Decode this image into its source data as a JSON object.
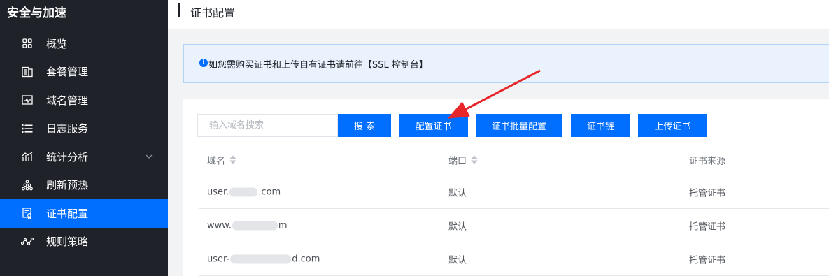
{
  "sidebar": {
    "title": "安全与加速",
    "items": [
      {
        "label": "概览",
        "icon": "grid-icon"
      },
      {
        "label": "套餐管理",
        "icon": "package-icon"
      },
      {
        "label": "域名管理",
        "icon": "domain-icon"
      },
      {
        "label": "日志服务",
        "icon": "list-icon"
      },
      {
        "label": "统计分析",
        "icon": "chart-icon"
      },
      {
        "label": "刷新预热",
        "icon": "tree-icon"
      },
      {
        "label": "证书配置",
        "icon": "certificate-icon",
        "active": true
      },
      {
        "label": "规则策略",
        "icon": "rule-icon"
      }
    ]
  },
  "header": {
    "title": "证书配置"
  },
  "notice": {
    "text": "如您需购买证书和上传自有证书请前往【SSL 控制台】"
  },
  "toolbar": {
    "search_placeholder": "输入域名搜索",
    "search_label": "搜 索",
    "configure_label": "配置证书",
    "batch_label": "证书批量配置",
    "chain_label": "证书链",
    "upload_label": "上传证书"
  },
  "table": {
    "headers": [
      "域名",
      "端口",
      "证书来源"
    ],
    "rows": [
      {
        "domain_prefix": "user.",
        "domain_suffix": ".com",
        "port": "默认",
        "source": "托管证书"
      },
      {
        "domain_prefix": "www.",
        "domain_suffix": "m",
        "port": "默认",
        "source": "托管证书"
      },
      {
        "domain_prefix": "user-",
        "domain_suffix": "d.com",
        "port": "默认",
        "source": "托管证书"
      }
    ]
  },
  "colors": {
    "accent": "#006eff",
    "sidebar_bg": "#1f2329",
    "annotation": "#e8262a"
  }
}
